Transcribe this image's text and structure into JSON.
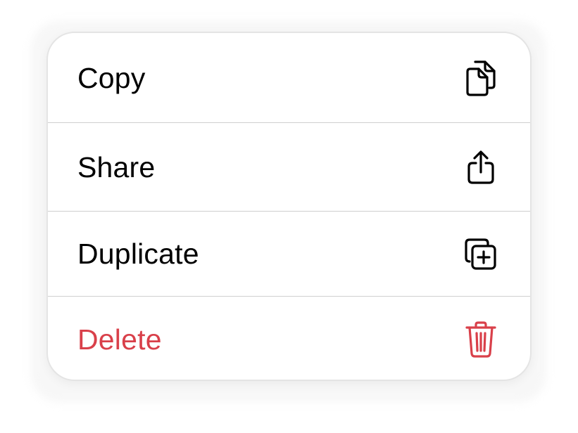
{
  "menu": {
    "items": [
      {
        "label": "Copy",
        "icon": "copy-icon",
        "destructive": false
      },
      {
        "label": "Share",
        "icon": "share-icon",
        "destructive": false
      },
      {
        "label": "Duplicate",
        "icon": "duplicate-icon",
        "destructive": false
      },
      {
        "label": "Delete",
        "icon": "trash-icon",
        "destructive": true
      }
    ]
  },
  "colors": {
    "text": "#000000",
    "destructive": "#d9404a",
    "divider": "#cfcfcf",
    "background": "#ffffff"
  }
}
